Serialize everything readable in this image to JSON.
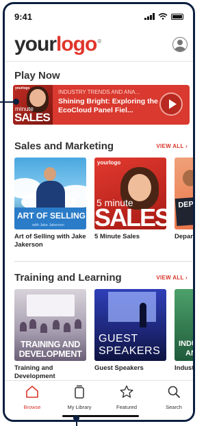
{
  "status": {
    "time": "9:41"
  },
  "header": {
    "logo_your": "your",
    "logo_mark": "logo",
    "logo_reg": "®"
  },
  "play_now": {
    "title": "Play Now",
    "banner": {
      "kicker": "INDUSTRY TRENDS AND ANA...",
      "title": "Shining Bright: Exploring the EcoCloud Panel Fiel...",
      "thumb_logo": "yourlogo",
      "thumb_minute": "minute",
      "thumb_sales": "SALES"
    }
  },
  "sales": {
    "title": "Sales and Marketing",
    "view_all": "VIEW ALL ›",
    "cards": [
      {
        "title": "Art of Selling with Jake Jakerson",
        "img_text": "ART OF SELLING",
        "img_sub": "with Jake Jakerson"
      },
      {
        "title": "5 Minute Sales",
        "img_logo": "yourlogo",
        "img_minute": "5 minute",
        "img_sales": "SALES"
      },
      {
        "title": "Depart Highlig",
        "img_text_1": "DEPA",
        "img_text_2": "HI"
      }
    ]
  },
  "training": {
    "title": "Training and Learning",
    "view_all": "VIEW ALL ›",
    "cards": [
      {
        "title": "Training and Development",
        "img_text_1": "TRAINING AND",
        "img_text_2": "DEVELOPMENT"
      },
      {
        "title": "Guest Speakers",
        "img_text_1": "GUEST",
        "img_text_2": "SPEAKERS"
      },
      {
        "title": "Industr Analysi",
        "img_text_1": "INDUS",
        "img_text_2": "AND"
      }
    ]
  },
  "tabs": [
    {
      "label": "Browse",
      "icon": "home-icon",
      "active": true
    },
    {
      "label": "My Library",
      "icon": "library-icon",
      "active": false
    },
    {
      "label": "Featured",
      "icon": "star-icon",
      "active": false
    },
    {
      "label": "Search",
      "icon": "search-icon",
      "active": false
    }
  ],
  "colors": {
    "accent": "#d8342a",
    "frame": "#0b1f3f"
  }
}
